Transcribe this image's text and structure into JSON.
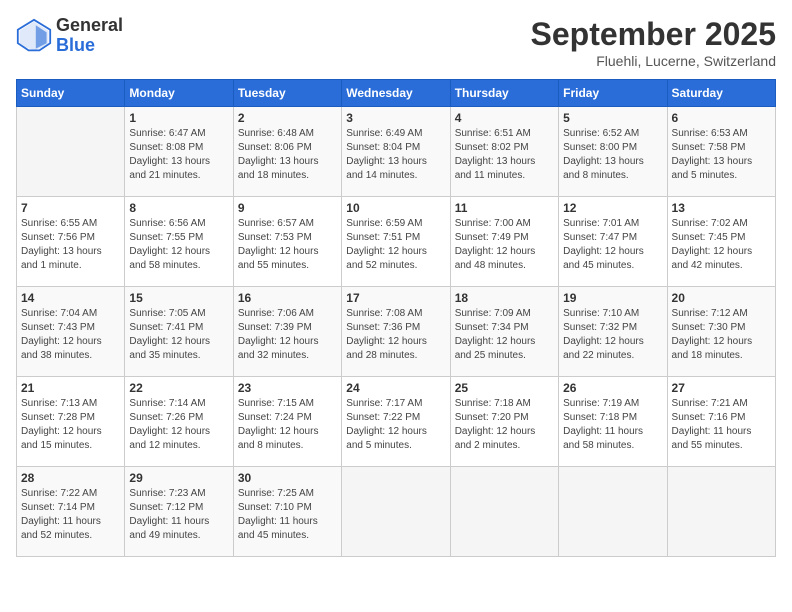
{
  "logo": {
    "general": "General",
    "blue": "Blue"
  },
  "title": "September 2025",
  "location": "Fluehli, Lucerne, Switzerland",
  "days_of_week": [
    "Sunday",
    "Monday",
    "Tuesday",
    "Wednesday",
    "Thursday",
    "Friday",
    "Saturday"
  ],
  "weeks": [
    [
      {
        "day": "",
        "info": ""
      },
      {
        "day": "1",
        "info": "Sunrise: 6:47 AM\nSunset: 8:08 PM\nDaylight: 13 hours\nand 21 minutes."
      },
      {
        "day": "2",
        "info": "Sunrise: 6:48 AM\nSunset: 8:06 PM\nDaylight: 13 hours\nand 18 minutes."
      },
      {
        "day": "3",
        "info": "Sunrise: 6:49 AM\nSunset: 8:04 PM\nDaylight: 13 hours\nand 14 minutes."
      },
      {
        "day": "4",
        "info": "Sunrise: 6:51 AM\nSunset: 8:02 PM\nDaylight: 13 hours\nand 11 minutes."
      },
      {
        "day": "5",
        "info": "Sunrise: 6:52 AM\nSunset: 8:00 PM\nDaylight: 13 hours\nand 8 minutes."
      },
      {
        "day": "6",
        "info": "Sunrise: 6:53 AM\nSunset: 7:58 PM\nDaylight: 13 hours\nand 5 minutes."
      }
    ],
    [
      {
        "day": "7",
        "info": "Sunrise: 6:55 AM\nSunset: 7:56 PM\nDaylight: 13 hours\nand 1 minute."
      },
      {
        "day": "8",
        "info": "Sunrise: 6:56 AM\nSunset: 7:55 PM\nDaylight: 12 hours\nand 58 minutes."
      },
      {
        "day": "9",
        "info": "Sunrise: 6:57 AM\nSunset: 7:53 PM\nDaylight: 12 hours\nand 55 minutes."
      },
      {
        "day": "10",
        "info": "Sunrise: 6:59 AM\nSunset: 7:51 PM\nDaylight: 12 hours\nand 52 minutes."
      },
      {
        "day": "11",
        "info": "Sunrise: 7:00 AM\nSunset: 7:49 PM\nDaylight: 12 hours\nand 48 minutes."
      },
      {
        "day": "12",
        "info": "Sunrise: 7:01 AM\nSunset: 7:47 PM\nDaylight: 12 hours\nand 45 minutes."
      },
      {
        "day": "13",
        "info": "Sunrise: 7:02 AM\nSunset: 7:45 PM\nDaylight: 12 hours\nand 42 minutes."
      }
    ],
    [
      {
        "day": "14",
        "info": "Sunrise: 7:04 AM\nSunset: 7:43 PM\nDaylight: 12 hours\nand 38 minutes."
      },
      {
        "day": "15",
        "info": "Sunrise: 7:05 AM\nSunset: 7:41 PM\nDaylight: 12 hours\nand 35 minutes."
      },
      {
        "day": "16",
        "info": "Sunrise: 7:06 AM\nSunset: 7:39 PM\nDaylight: 12 hours\nand 32 minutes."
      },
      {
        "day": "17",
        "info": "Sunrise: 7:08 AM\nSunset: 7:36 PM\nDaylight: 12 hours\nand 28 minutes."
      },
      {
        "day": "18",
        "info": "Sunrise: 7:09 AM\nSunset: 7:34 PM\nDaylight: 12 hours\nand 25 minutes."
      },
      {
        "day": "19",
        "info": "Sunrise: 7:10 AM\nSunset: 7:32 PM\nDaylight: 12 hours\nand 22 minutes."
      },
      {
        "day": "20",
        "info": "Sunrise: 7:12 AM\nSunset: 7:30 PM\nDaylight: 12 hours\nand 18 minutes."
      }
    ],
    [
      {
        "day": "21",
        "info": "Sunrise: 7:13 AM\nSunset: 7:28 PM\nDaylight: 12 hours\nand 15 minutes."
      },
      {
        "day": "22",
        "info": "Sunrise: 7:14 AM\nSunset: 7:26 PM\nDaylight: 12 hours\nand 12 minutes."
      },
      {
        "day": "23",
        "info": "Sunrise: 7:15 AM\nSunset: 7:24 PM\nDaylight: 12 hours\nand 8 minutes."
      },
      {
        "day": "24",
        "info": "Sunrise: 7:17 AM\nSunset: 7:22 PM\nDaylight: 12 hours\nand 5 minutes."
      },
      {
        "day": "25",
        "info": "Sunrise: 7:18 AM\nSunset: 7:20 PM\nDaylight: 12 hours\nand 2 minutes."
      },
      {
        "day": "26",
        "info": "Sunrise: 7:19 AM\nSunset: 7:18 PM\nDaylight: 11 hours\nand 58 minutes."
      },
      {
        "day": "27",
        "info": "Sunrise: 7:21 AM\nSunset: 7:16 PM\nDaylight: 11 hours\nand 55 minutes."
      }
    ],
    [
      {
        "day": "28",
        "info": "Sunrise: 7:22 AM\nSunset: 7:14 PM\nDaylight: 11 hours\nand 52 minutes."
      },
      {
        "day": "29",
        "info": "Sunrise: 7:23 AM\nSunset: 7:12 PM\nDaylight: 11 hours\nand 49 minutes."
      },
      {
        "day": "30",
        "info": "Sunrise: 7:25 AM\nSunset: 7:10 PM\nDaylight: 11 hours\nand 45 minutes."
      },
      {
        "day": "",
        "info": ""
      },
      {
        "day": "",
        "info": ""
      },
      {
        "day": "",
        "info": ""
      },
      {
        "day": "",
        "info": ""
      }
    ]
  ]
}
